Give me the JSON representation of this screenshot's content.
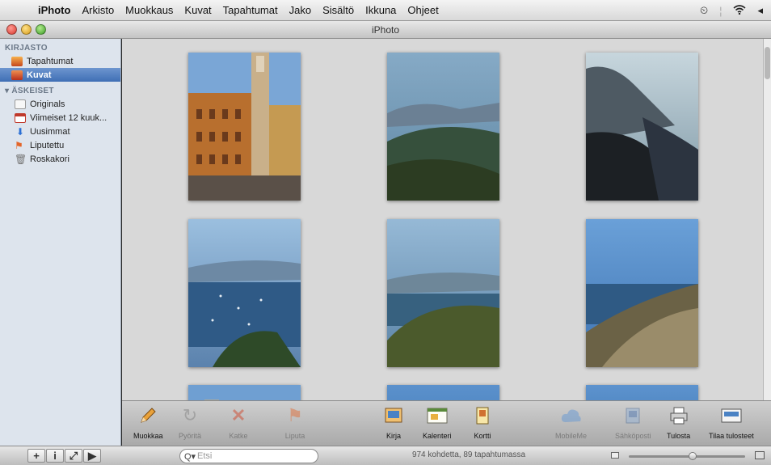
{
  "menubar": {
    "apple": "",
    "app_name": "iPhoto",
    "items": [
      "Arkisto",
      "Muokkaus",
      "Kuvat",
      "Tapahtumat",
      "Jako",
      "Sisältö",
      "Ikkuna",
      "Ohjeet"
    ],
    "clock_icon": "⏲",
    "wifi_icon": "wifi-icon",
    "volume_icon": "◂"
  },
  "window": {
    "title": "iPhoto"
  },
  "sidebar": {
    "library_header": "KIRJASTO",
    "library_items": [
      {
        "label": "Tapahtumat",
        "icon": "events-icon",
        "selected": false
      },
      {
        "label": "Kuvat",
        "icon": "photos-icon",
        "selected": true
      }
    ],
    "recent_header": "▾ ÄSKEISET",
    "recent_items": [
      {
        "label": "Originals",
        "icon": "originals-icon"
      },
      {
        "label": "Viimeiset 12 kuuk...",
        "icon": "calendar-icon"
      },
      {
        "label": "Uusimmat",
        "icon": "import-icon"
      },
      {
        "label": "Liputettu",
        "icon": "flag-icon"
      },
      {
        "label": "Roskakori",
        "icon": "trash-icon"
      }
    ]
  },
  "photos": [
    {
      "name": "photo-church-tower",
      "palette": [
        "#7aa6d6",
        "#b86f2e",
        "#7a4020",
        "#5a5048"
      ]
    },
    {
      "name": "photo-coast-village",
      "palette": [
        "#86aac6",
        "#5f87a3",
        "#36503c",
        "#2c3c22"
      ]
    },
    {
      "name": "photo-cliff-sea",
      "palette": [
        "#c7d6dd",
        "#7e98a6",
        "#2c3440",
        "#1c2024"
      ]
    },
    {
      "name": "photo-bay-boats",
      "palette": [
        "#9bbfdf",
        "#5b82ad",
        "#2f5a86",
        "#2e4a28"
      ]
    },
    {
      "name": "photo-coast-hill",
      "palette": [
        "#96b9d6",
        "#5a83a6",
        "#37617f",
        "#4b5a2c"
      ]
    },
    {
      "name": "photo-coastal-town",
      "palette": [
        "#6aa0d8",
        "#3f74b2",
        "#2f5a84",
        "#6b6246"
      ]
    },
    {
      "name": "photo-church-partial",
      "palette": [
        "#6f9fd2",
        "#9aa09a"
      ]
    },
    {
      "name": "photo-sky-partial-1",
      "palette": [
        "#5b91cc",
        "#4f86c2"
      ]
    },
    {
      "name": "photo-sky-partial-2",
      "palette": [
        "#5d93ce",
        "#4d84c0"
      ]
    }
  ],
  "toolbar": {
    "buttons": [
      {
        "label": "Muokkaa",
        "icon": "pencil-icon",
        "enabled": true
      },
      {
        "label": "Pyöritä",
        "icon": "rotate-icon",
        "enabled": false
      },
      {
        "label": "Katke",
        "icon": "delete-icon",
        "enabled": false
      },
      {
        "label": "Liputa",
        "icon": "flag-icon",
        "enabled": false
      },
      {
        "label": "Kirja",
        "icon": "book-icon",
        "enabled": true
      },
      {
        "label": "Kalenteri",
        "icon": "calendar-icon",
        "enabled": true
      },
      {
        "label": "Kortti",
        "icon": "card-icon",
        "enabled": true
      },
      {
        "label": "MobileMe",
        "icon": "mobileme-icon",
        "enabled": false
      },
      {
        "label": "Sähköposti",
        "icon": "email-icon",
        "enabled": false
      },
      {
        "label": "Tulosta",
        "icon": "print-icon",
        "enabled": true
      },
      {
        "label": "Tilaa tulosteet",
        "icon": "order-prints-icon",
        "enabled": true
      }
    ]
  },
  "bottombar": {
    "add_label": "+",
    "info_label": "i",
    "fullscreen_label": "⤢",
    "play_label": "▶",
    "search_placeholder": "Etsi",
    "search_icon_label": "Q▾",
    "status": "974 kohdetta, 89 tapahtumassa",
    "zoom_level": 0.55
  }
}
